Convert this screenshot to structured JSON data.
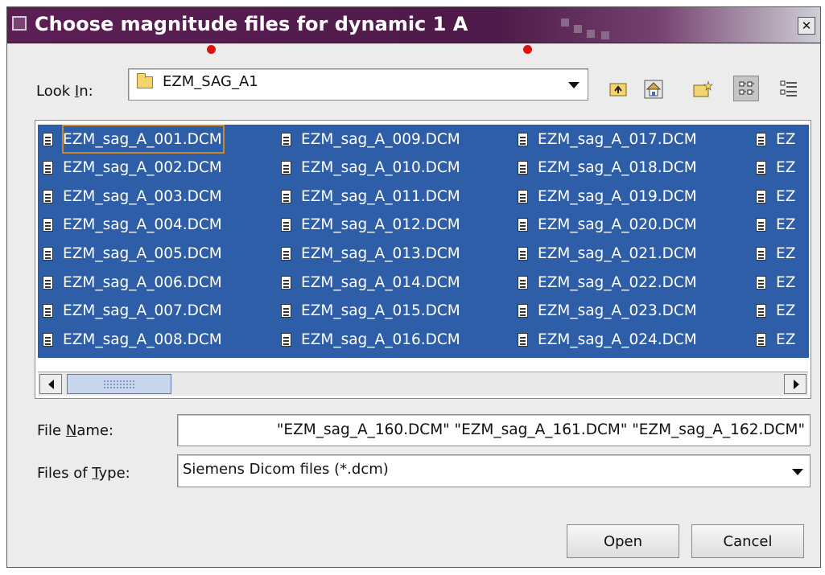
{
  "window": {
    "title": "Choose magnitude files for dynamic 1 A",
    "close_symbol": "✕"
  },
  "look_in": {
    "label_pre": "Look ",
    "label_mnemonic": "I",
    "label_post": "n:",
    "value": "EZM_SAG_A1",
    "icon": "folder-icon"
  },
  "toolbar": {
    "buttons": [
      "up-folder-icon",
      "home-icon",
      "new-folder-icon",
      "list-view-icon",
      "details-view-icon"
    ]
  },
  "files": {
    "columns": [
      [
        "EZM_sag_A_001.DCM",
        "EZM_sag_A_002.DCM",
        "EZM_sag_A_003.DCM",
        "EZM_sag_A_004.DCM",
        "EZM_sag_A_005.DCM",
        "EZM_sag_A_006.DCM",
        "EZM_sag_A_007.DCM",
        "EZM_sag_A_008.DCM"
      ],
      [
        "EZM_sag_A_009.DCM",
        "EZM_sag_A_010.DCM",
        "EZM_sag_A_011.DCM",
        "EZM_sag_A_012.DCM",
        "EZM_sag_A_013.DCM",
        "EZM_sag_A_014.DCM",
        "EZM_sag_A_015.DCM",
        "EZM_sag_A_016.DCM"
      ],
      [
        "EZM_sag_A_017.DCM",
        "EZM_sag_A_018.DCM",
        "EZM_sag_A_019.DCM",
        "EZM_sag_A_020.DCM",
        "EZM_sag_A_021.DCM",
        "EZM_sag_A_022.DCM",
        "EZM_sag_A_023.DCM",
        "EZM_sag_A_024.DCM"
      ],
      [
        "EZ",
        "EZ",
        "EZ",
        "EZ",
        "EZ",
        "EZ",
        "EZ",
        "EZ"
      ]
    ],
    "selection_color": "#2f5ea8",
    "focus_color": "#c98a2e"
  },
  "file_name": {
    "label_pre": "File ",
    "label_mnemonic": "N",
    "label_post": "ame:",
    "value": "\"EZM_sag_A_160.DCM\" \"EZM_sag_A_161.DCM\" \"EZM_sag_A_162.DCM\""
  },
  "file_type": {
    "label_pre": "Files of ",
    "label_mnemonic": "T",
    "label_post": "ype:",
    "value": "Siemens Dicom files (*.dcm)"
  },
  "actions": {
    "open_label": "Open",
    "cancel_label": "Cancel"
  },
  "colors": {
    "titlebar": "#5b1f55",
    "marker": "#e01010"
  }
}
